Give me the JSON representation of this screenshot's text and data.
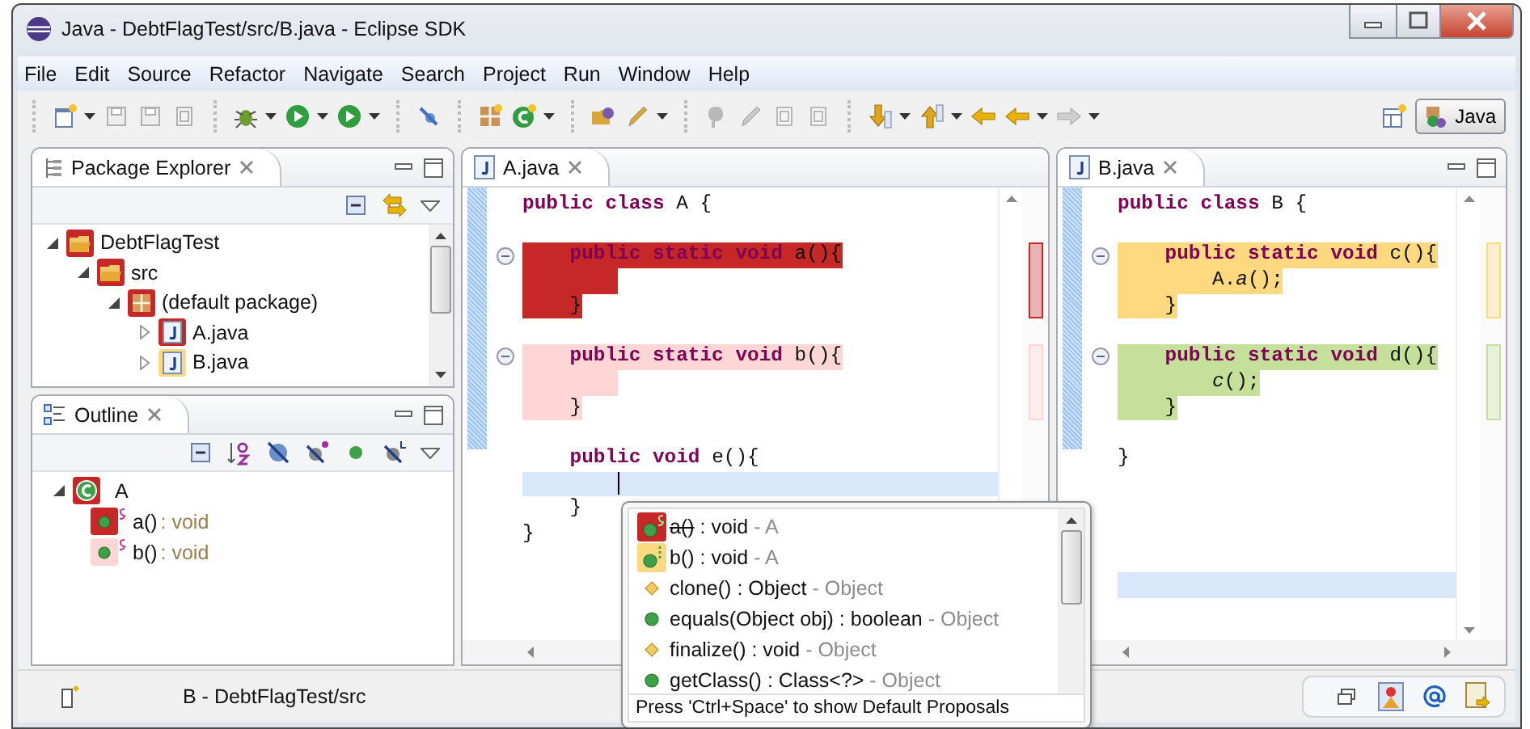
{
  "window": {
    "title": "Java - DebtFlagTest/src/B.java - Eclipse SDK"
  },
  "menu": [
    "File",
    "Edit",
    "Source",
    "Refactor",
    "Navigate",
    "Search",
    "Project",
    "Run",
    "Window",
    "Help"
  ],
  "perspective": {
    "label": "Java",
    "selected": true
  },
  "package_explorer": {
    "title": "Package Explorer",
    "tree": [
      {
        "label": "DebtFlagTest",
        "kind": "project",
        "color": "#c62828",
        "expanded": true,
        "children": [
          {
            "label": "src",
            "kind": "folder",
            "color": "#c62828",
            "expanded": true,
            "children": [
              {
                "label": "(default package)",
                "kind": "package",
                "color": "#c62828",
                "expanded": true,
                "children": [
                  {
                    "label": "A.java",
                    "kind": "file",
                    "color": "#c62828",
                    "expanded": false
                  },
                  {
                    "label": "B.java",
                    "kind": "file",
                    "color": "#ffd980",
                    "expanded": false
                  }
                ]
              }
            ]
          }
        ]
      }
    ]
  },
  "outline": {
    "title": "Outline",
    "tree": [
      {
        "label": "A",
        "kind": "class",
        "color": "#c62828",
        "expanded": true,
        "children": [
          {
            "label": "a()",
            "type": ": void",
            "kind": "method",
            "color": "#c62828"
          },
          {
            "label": "b()",
            "type": ": void",
            "kind": "method",
            "color": "#ffd6d6"
          }
        ]
      }
    ]
  },
  "editors": [
    {
      "tab": "A.java",
      "selected": true,
      "lines": [
        {
          "text": "**public** **class** A {",
          "fold": false,
          "current": false
        },
        {
          "fold": false,
          "current": false
        },
        {
          "text": "    **public** **static** **void** a(){",
          "color": "#c62828",
          "fold": true,
          "current": false
        },
        {
          "color": "#c62828",
          "fold": false,
          "current": false
        },
        {
          "text": "    }",
          "color": "#c62828",
          "fold": false,
          "current": false
        },
        {
          "fold": false,
          "current": false
        },
        {
          "text": "    **public** **static** **void** b(){",
          "color": "#ffd6d6",
          "fold": true,
          "current": false
        },
        {
          "color": "#ffd6d6",
          "fold": false,
          "current": false
        },
        {
          "text": "    }",
          "color": "#ffd6d6",
          "fold": false,
          "current": false
        },
        {
          "fold": false,
          "current": false
        },
        {
          "text": "    **public** **void** e(){",
          "fold": false,
          "current": false
        },
        {
          "fold": false,
          "current": true
        },
        {
          "text": "    }",
          "fold": false,
          "current": false
        },
        {
          "text": "}",
          "fold": false,
          "current": false
        }
      ]
    },
    {
      "tab": "B.java",
      "selected": true,
      "lines": [
        {
          "text": "**public** **class** B {",
          "fold": false,
          "current": false
        },
        {
          "fold": false,
          "current": false
        },
        {
          "text": "    **public** **static** **void** c(){",
          "color": "#ffd980",
          "fold": true,
          "current": false
        },
        {
          "text": "        A.*a*();",
          "color": "#ffd980",
          "fold": false,
          "current": false
        },
        {
          "text": "    }",
          "color": "#ffd980",
          "fold": false,
          "current": false
        },
        {
          "fold": false,
          "current": false
        },
        {
          "text": "    **public** **static** **void** d(){",
          "color": "#c5e09a",
          "fold": true,
          "current": false
        },
        {
          "text": "        *c*();",
          "color": "#c5e09a",
          "fold": false,
          "current": false
        },
        {
          "text": "    }",
          "color": "#c5e09a",
          "fold": false,
          "current": false
        },
        {
          "fold": false,
          "current": false
        },
        {
          "text": "}",
          "fold": false,
          "current": false
        },
        {
          "fold": false,
          "current": false
        },
        {
          "fold": false,
          "current": false
        },
        {
          "fold": false,
          "current": false
        },
        {
          "fold": false,
          "current": false
        },
        {
          "fold": false,
          "current": true
        }
      ]
    }
  ],
  "completion": {
    "items": [
      {
        "name": "a()",
        "signature": ": void",
        "qualifier": "- A",
        "kind": "static",
        "color": "#c62828",
        "deprecated": true
      },
      {
        "name": "b()",
        "signature": ": void",
        "qualifier": "- A",
        "kind": "default",
        "color": "#ffd980",
        "deprecated": false
      },
      {
        "name": "clone()",
        "signature": ": Object",
        "qualifier": "- Object",
        "kind": "protected",
        "deprecated": false
      },
      {
        "name": "equals(Object obj)",
        "signature": ": boolean",
        "qualifier": "- Object",
        "kind": "public",
        "deprecated": false
      },
      {
        "name": "finalize()",
        "signature": ": void",
        "qualifier": "- Object",
        "kind": "protected",
        "deprecated": false
      },
      {
        "name": "getClass()",
        "signature": ": Class<?>",
        "qualifier": "- Object",
        "kind": "public",
        "deprecated": false
      }
    ],
    "footer": "Press 'Ctrl+Space' to show Default Proposals"
  },
  "status_bar": {
    "text": "B - DebtFlagTest/src"
  }
}
